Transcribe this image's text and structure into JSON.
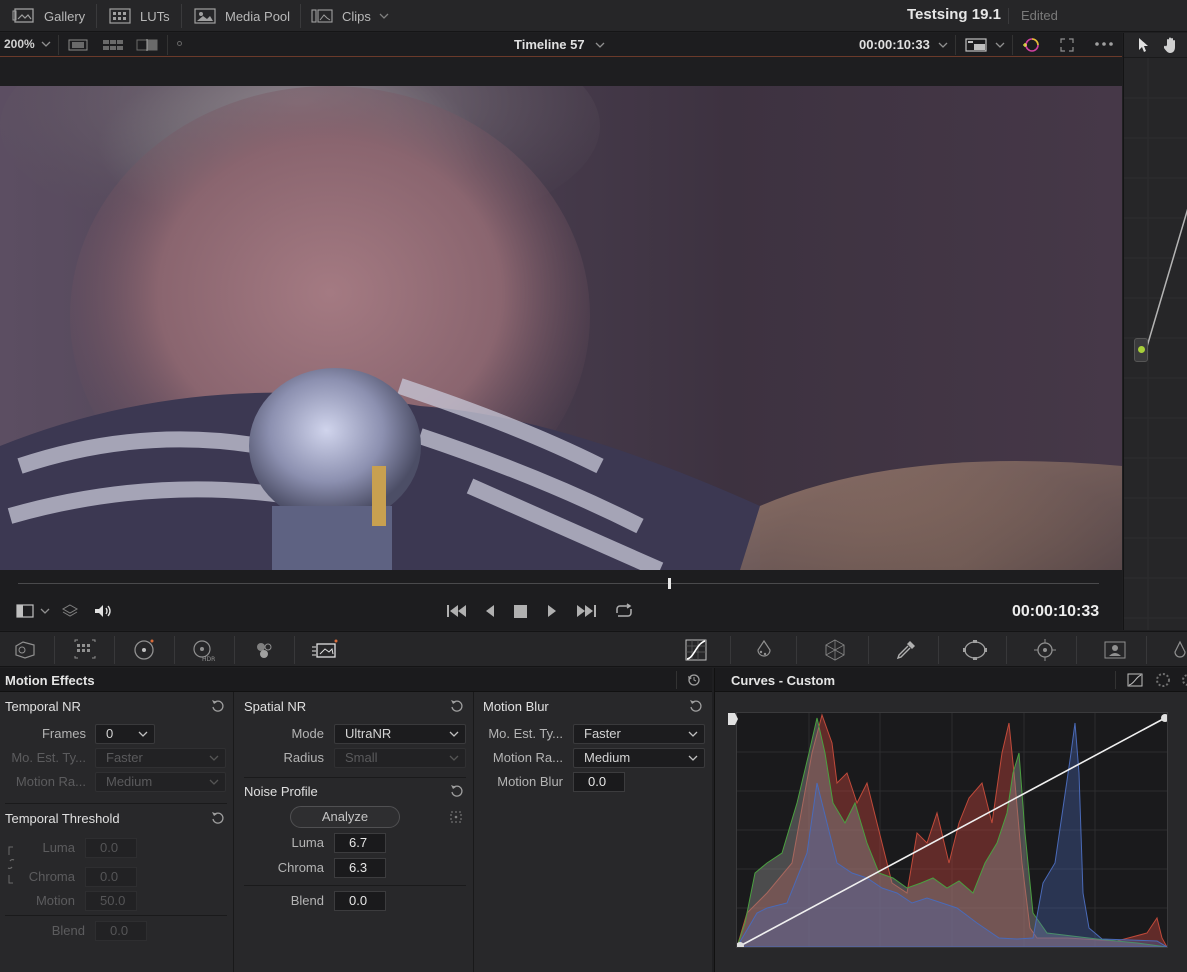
{
  "topbar": {
    "gallery": "Gallery",
    "luts": "LUTs",
    "media_pool": "Media Pool",
    "clips": "Clips",
    "project_title": "Testsing 19.1",
    "project_status": "Edited"
  },
  "viewer": {
    "zoom": "200%",
    "timeline_name": "Timeline 57",
    "timecode_top": "00:00:10:33",
    "timecode_main": "00:00:10:33",
    "playhead_fraction": 0.602
  },
  "motion_effects": {
    "title": "Motion Effects",
    "temporal_nr": {
      "title": "Temporal NR",
      "frames_label": "Frames",
      "frames_value": "0",
      "mo_est_label": "Mo. Est. Ty...",
      "mo_est_value": "Faster",
      "motion_range_label": "Motion Ra...",
      "motion_range_value": "Medium"
    },
    "temporal_threshold": {
      "title": "Temporal Threshold",
      "luma_label": "Luma",
      "luma_value": "0.0",
      "chroma_label": "Chroma",
      "chroma_value": "0.0",
      "motion_label": "Motion",
      "motion_value": "50.0",
      "blend_label": "Blend",
      "blend_value": "0.0"
    },
    "spatial_nr": {
      "title": "Spatial NR",
      "mode_label": "Mode",
      "mode_value": "UltraNR",
      "radius_label": "Radius",
      "radius_value": "Small"
    },
    "noise_profile": {
      "title": "Noise Profile",
      "analyze_label": "Analyze",
      "luma_label": "Luma",
      "luma_value": "6.7",
      "chroma_label": "Chroma",
      "chroma_value": "6.3",
      "blend_label": "Blend",
      "blend_value": "0.0"
    },
    "motion_blur": {
      "title": "Motion Blur",
      "mo_est_label": "Mo. Est. Ty...",
      "mo_est_value": "Faster",
      "motion_range_label": "Motion Ra...",
      "motion_range_value": "Medium",
      "blur_label": "Motion Blur",
      "blur_value": "0.0"
    }
  },
  "curves": {
    "title": "Curves - Custom"
  },
  "colors": {
    "accent_orange": "#d96b3a",
    "node_green": "#a8d03a",
    "hist_red": "#b8413a",
    "hist_green": "#4aa040",
    "hist_blue": "#4a6ab8"
  },
  "icons": {
    "gallery": "gallery-icon",
    "luts": "luts-icon",
    "media_pool": "media-pool-icon",
    "clips": "clips-icon"
  }
}
